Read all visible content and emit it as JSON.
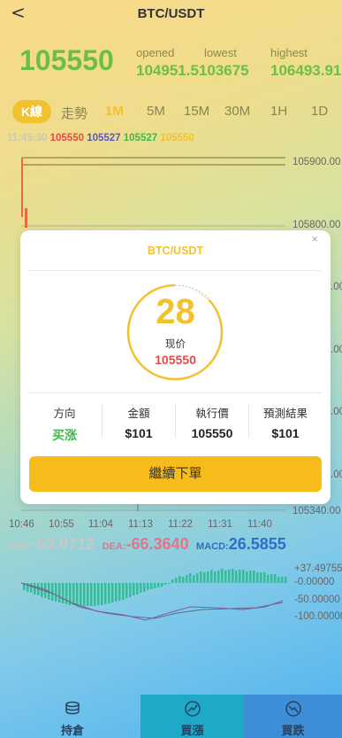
{
  "header": {
    "back_icon": "chevron-left-icon",
    "back_glyph": "<",
    "title": "BTC/USDT"
  },
  "ticker": {
    "price": "105550",
    "opened_label": "opened",
    "opened_value": "104951.5103675",
    "lowest_label": "lowest",
    "lowest_value": "104951.5103675",
    "highest_label": "highest",
    "highest_value": "106493.91"
  },
  "tabs": [
    {
      "label": "K線"
    },
    {
      "label": "走勢"
    },
    {
      "label": "1M"
    },
    {
      "label": "5M"
    },
    {
      "label": "15M"
    },
    {
      "label": "30M"
    },
    {
      "label": "1H"
    },
    {
      "label": "1D"
    }
  ],
  "candle_info": {
    "time": "11:45:30",
    "o": "105550",
    "h": "105527",
    "l": "105527",
    "c": "105550"
  },
  "chart": {
    "y_labels": [
      "105900.00",
      "105800.00",
      ".00",
      ".00",
      ".00",
      ".00",
      "105340.00"
    ],
    "x_labels": [
      "10:46",
      "10:55",
      "11:04",
      "11:13",
      "11:22",
      "11:31",
      "11:40"
    ]
  },
  "indicators": {
    "diff_label": "DIFF:",
    "diff_value": "-53.0712",
    "dea_label": "DEA:",
    "dea_value": "-66.3640",
    "macd_label": "MACD:",
    "macd_value": "26.5855",
    "levels": [
      "+37.49755",
      "-0.00000",
      "-50.00000",
      "-100.00000"
    ]
  },
  "modal": {
    "close_glyph": "×",
    "title": "BTC/USDT",
    "countdown": "28",
    "current_price_label": "现价",
    "current_price": "105550",
    "columns": [
      {
        "label": "方向",
        "value": "买涨"
      },
      {
        "label": "金額",
        "value": "$101"
      },
      {
        "label": "執行價",
        "value": "105550"
      },
      {
        "label": "預測結果",
        "value": "$101"
      }
    ],
    "continue_label": "繼續下單"
  },
  "bottom_nav": [
    {
      "label": "持倉",
      "icon": "coins-icon"
    },
    {
      "label": "買漲",
      "icon": "trend-up-icon"
    },
    {
      "label": "買跌",
      "icon": "trend-down-icon"
    }
  ],
  "colors": {
    "accent": "#f2c22e",
    "up": "#6cbf45",
    "down": "#e84a4a",
    "nav_up_bg": "#1fa9c9",
    "nav_down_bg": "#3d8ed6"
  }
}
